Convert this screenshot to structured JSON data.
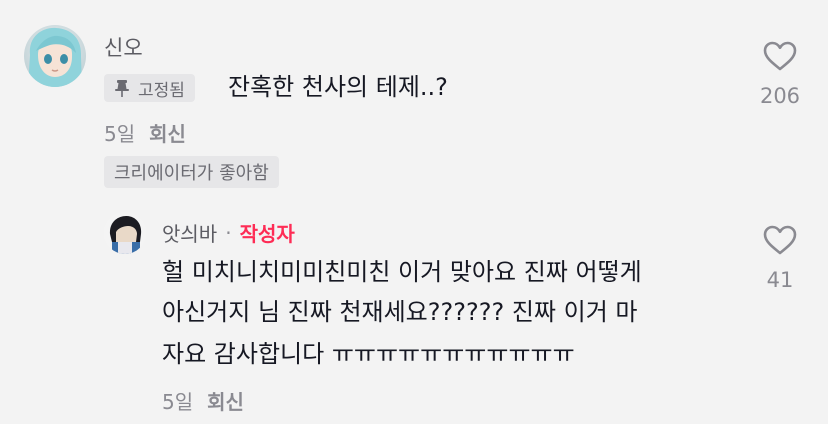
{
  "comment": {
    "username": "신오",
    "pinned_label": "고정됨",
    "text": "잔혹한 천사의 테제..?",
    "time": "5일",
    "reply_label": "회신",
    "creator_liked": "크리에이터가 좋아함",
    "likes": "206"
  },
  "reply": {
    "username": "앗싀바",
    "separator": "·",
    "author_label": "작성자",
    "lines": [
      "헐 미치니치미미친미친 이거 맞아요 진짜 어떻게",
      "아신거지 님 진짜 천재세요?????? 진짜 이거 마",
      "자요 감사합니다 ㅠㅠㅠㅠㅠㅠㅠㅠㅠㅠㅠ"
    ],
    "time": "5일",
    "reply_label": "회신",
    "likes": "41"
  },
  "colors": {
    "background": "#f3f3f3",
    "creator_accent": "#fe2c55",
    "muted_text": "#8a8a91"
  },
  "icons": {
    "pin": "pin-icon",
    "heart": "heart-outline-icon"
  }
}
